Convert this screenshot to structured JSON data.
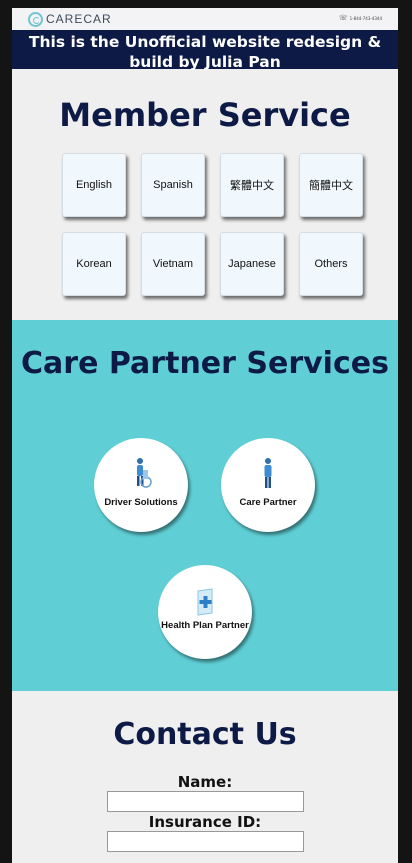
{
  "header": {
    "logo_text_care": "CARE",
    "logo_text_car": "CAR",
    "phone": "1-844-743-4344"
  },
  "banner": {
    "text": "This is the Unofficial website redesign & build by Julia Pan"
  },
  "member_service": {
    "title": "Member Service",
    "languages": [
      "English",
      "Spanish",
      "繁體中文",
      "簡體中文",
      "Korean",
      "Vietnam",
      "Japanese",
      "Others"
    ]
  },
  "care_partner": {
    "title": "Care Partner Services",
    "items": [
      {
        "label": "Driver Solutions",
        "icon": "driver-icon"
      },
      {
        "label": "Care Partner",
        "icon": "care-partner-icon"
      },
      {
        "label": "Health Plan Partner",
        "icon": "health-plan-icon"
      }
    ]
  },
  "contact": {
    "title": "Contact Us",
    "fields": [
      {
        "label": "Name:",
        "value": ""
      },
      {
        "label": "Insurance ID:",
        "value": ""
      }
    ]
  },
  "colors": {
    "navy": "#0d1a46",
    "teal": "#5fcfd5",
    "page_bg": "#efefef"
  }
}
